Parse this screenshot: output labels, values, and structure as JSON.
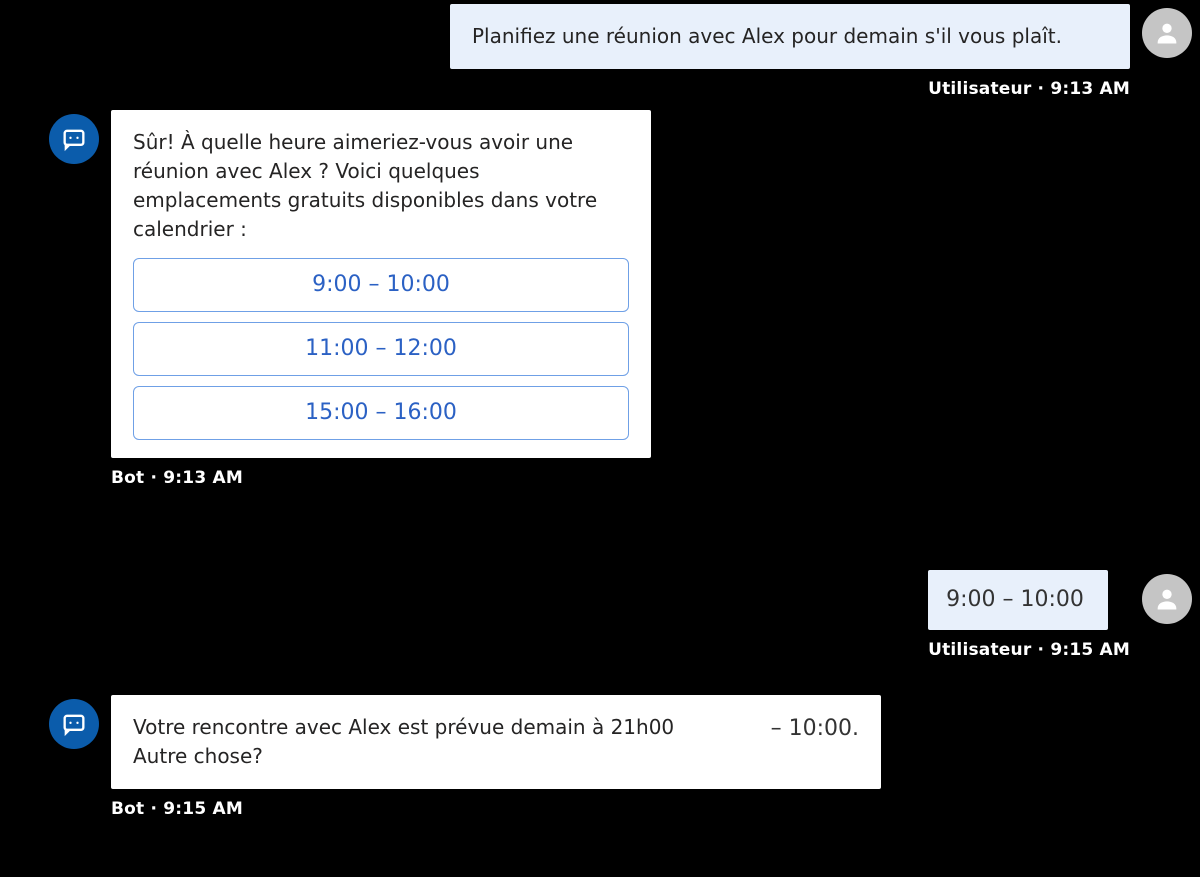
{
  "messages": {
    "user1": {
      "text": "Planifiez une réunion avec Alex pour demain s'il vous plaît.",
      "meta": "Utilisateur · 9:13 AM"
    },
    "bot1": {
      "text": "Sûr! À quelle heure aimeriez-vous avoir une réunion avec Alex ? Voici quelques emplacements gratuits disponibles dans votre calendrier :",
      "slots": [
        "9:00 – 10:00",
        "11:00 – 12:00",
        "15:00 – 16:00"
      ],
      "meta": "Bot · 9:13 AM"
    },
    "user2": {
      "text": "9:00 – 10:00",
      "meta": "Utilisateur · 9:15 AM"
    },
    "bot2": {
      "text": "Votre rencontre avec Alex est prévue demain à 21h00 Autre chose?",
      "extra": "– 10:00.",
      "meta": "Bot · 9:15 AM"
    }
  }
}
